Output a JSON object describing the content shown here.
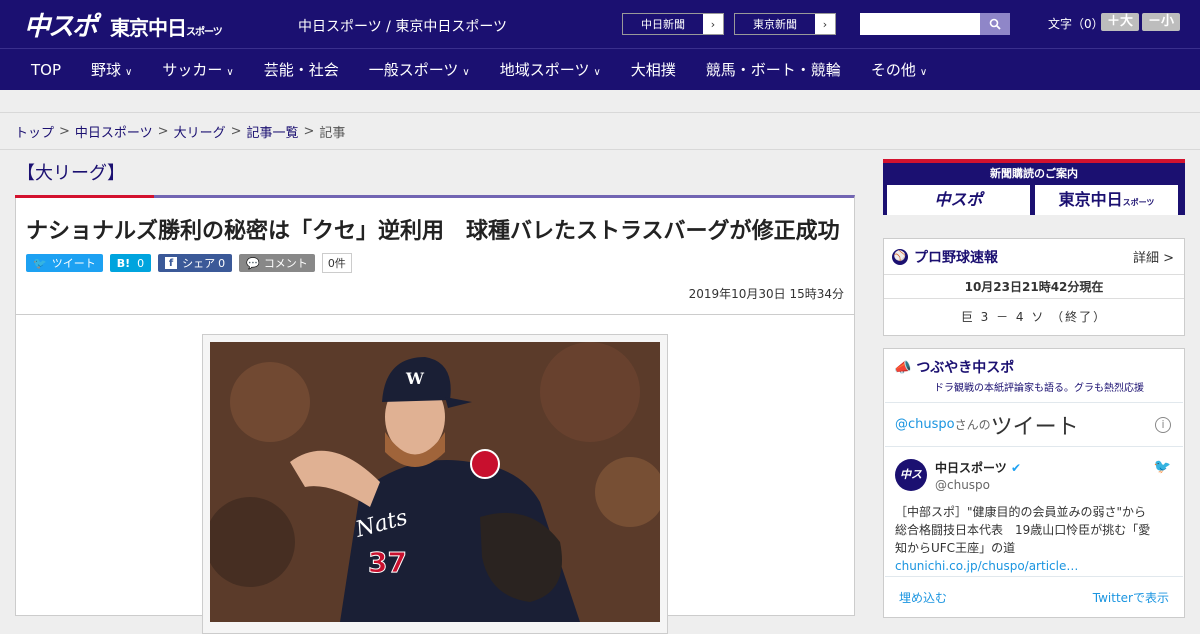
{
  "header": {
    "logo_chuspo": "中スポ",
    "logo_tokyo": "東京中日",
    "logo_tokyo_small": "スポーツ",
    "site_title": "中日スポーツ / 東京中日スポーツ",
    "paper1": "中日新聞",
    "paper2": "東京新聞",
    "font_size_label": "文字（0）",
    "font_larger": "＋大",
    "font_smaller": "－小"
  },
  "nav": [
    "TOP",
    "野球",
    "サッカー",
    "芸能・社会",
    "一般スポーツ",
    "地域スポーツ",
    "大相撲",
    "競馬・ボート・競輪",
    "その他"
  ],
  "breadcrumb": {
    "items": [
      "トップ",
      "中日スポーツ",
      "大リーグ",
      "記事一覧"
    ],
    "current": "記事",
    "sep": ">"
  },
  "article": {
    "category": "【大リーグ】",
    "headline": "ナショナルズ勝利の秘密は「クセ」逆利用　球種バレたストラスバーグが修正成功",
    "tweet": "ツイート",
    "hatena": "B!",
    "hatena_count": "0",
    "share": "シェア",
    "share_count": "0",
    "comment": "コメント",
    "comment_count": "0件",
    "date": "2019年10月30日 15時34分"
  },
  "sidebar": {
    "subscribe_title": "新聞購読のご案内",
    "sub_chuspo": "中スポ",
    "sub_tokyo": "東京中日",
    "sub_tokyo_small": "スポーツ",
    "baseball_title": "プロ野球速報",
    "baseball_detail": "詳細 >",
    "baseball_time": "10月23日21時42分現在",
    "baseball_score": "巨 3 － 4 ソ （終了）",
    "tsubuyaki_title": "つぶやき中スポ",
    "tsubuyaki_sub": "ドラ観戦の本紙評論家も語る。グラも熱烈応援",
    "tw_user": "@chuspo",
    "tw_san": "さんの",
    "tw_tweet": "ツイート",
    "tw_name": "中日スポーツ",
    "tw_handle": "@chuspo",
    "tw_text": "［中部スポ］\"健康目的の会員並みの弱さ\"から総合格闘技日本代表　19歳山口怜臣が挑む「愛知からUFC王座」の道",
    "tw_link": "chunichi.co.jp/chuspo/article…",
    "tw_embed": "埋め込む",
    "tw_view": "Twitterで表示"
  }
}
